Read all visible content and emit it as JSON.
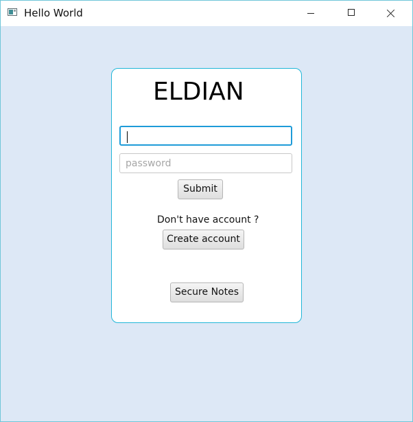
{
  "window": {
    "title": "Hello World",
    "icon": "window-app-icon"
  },
  "login": {
    "title": "ELDIAN",
    "username": {
      "value": "",
      "placeholder": ""
    },
    "password": {
      "value": "",
      "placeholder": "password"
    },
    "submit_label": "Submit",
    "account_prompt": "Don't have account ?",
    "create_account_label": "Create account",
    "secure_notes_label": "Secure Notes"
  },
  "colors": {
    "background": "#dde8f6",
    "card_border": "#1fb6d8",
    "focus_border": "#1e9bd8"
  }
}
